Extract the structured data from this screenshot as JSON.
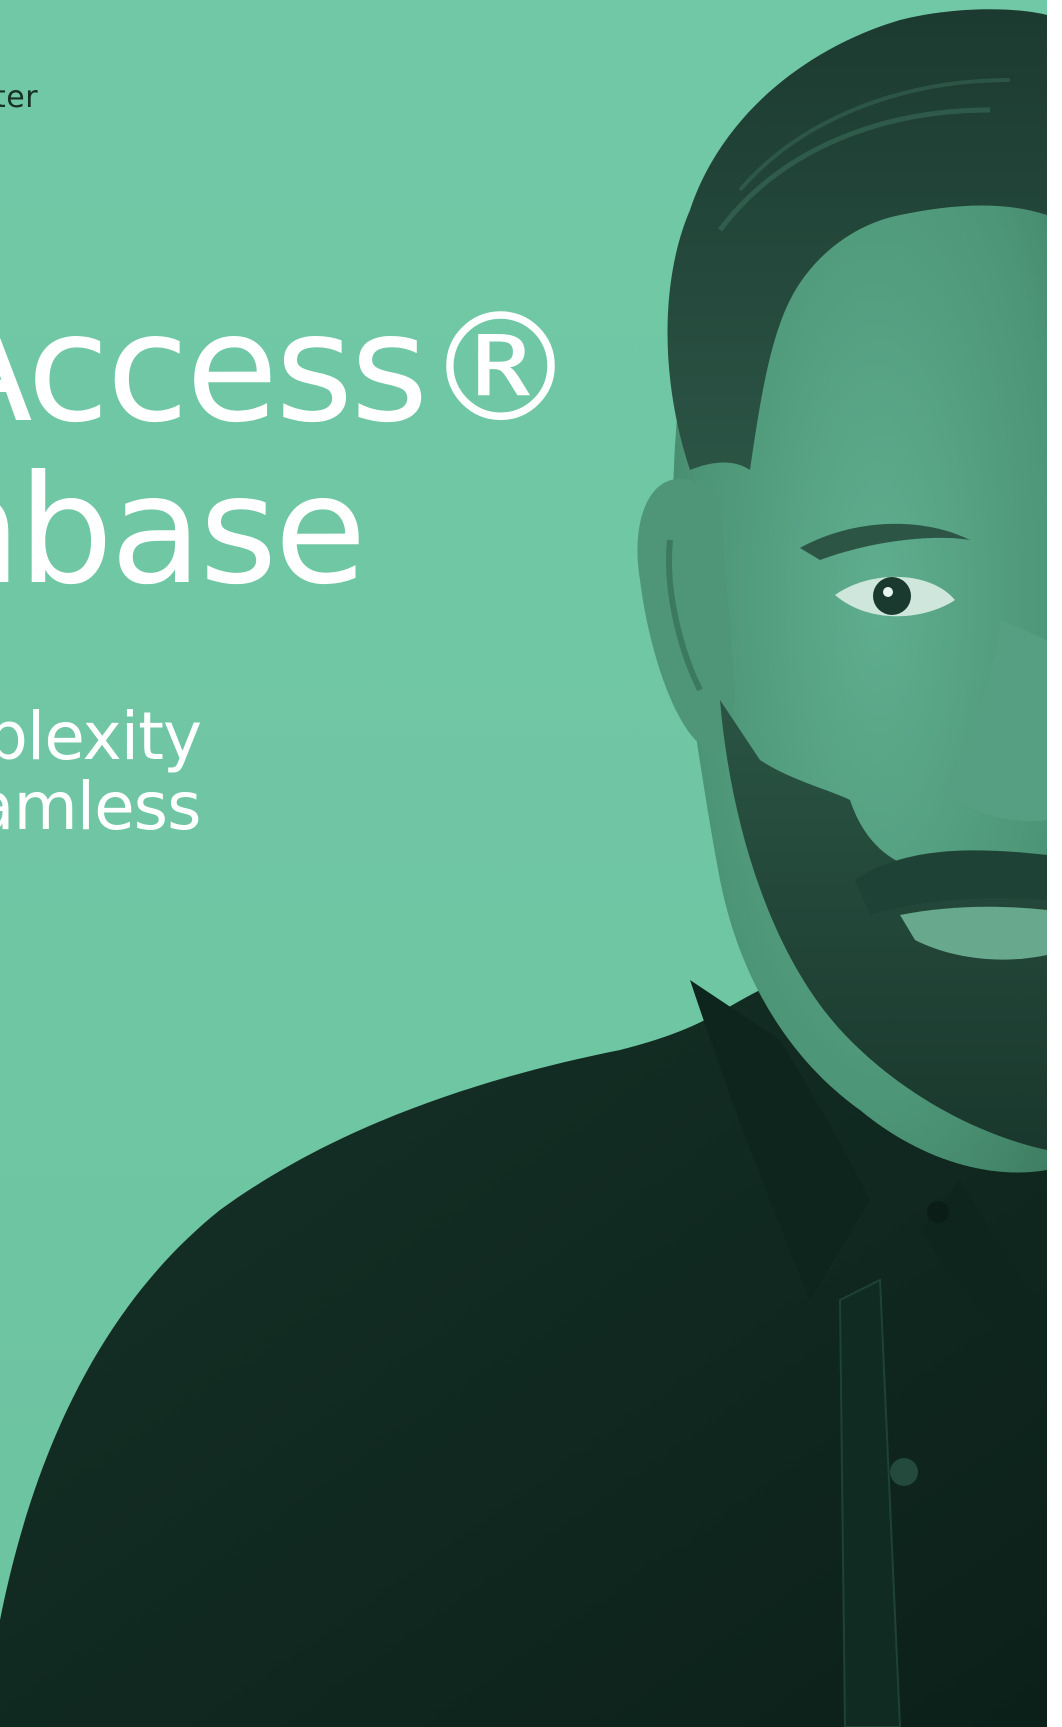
{
  "cover": {
    "eyebrow": "ter",
    "headline": {
      "line1": "Access®",
      "line2": "nbase"
    },
    "subline": {
      "line1": "plexity",
      "line2": "amless"
    }
  },
  "colors": {
    "background": "#71c8a6",
    "headline_text": "#ffffff",
    "eyebrow_text": "#173028",
    "duotone_dark": "#0f2a22"
  },
  "image": {
    "subject": "portrait-man-duotone-green"
  }
}
